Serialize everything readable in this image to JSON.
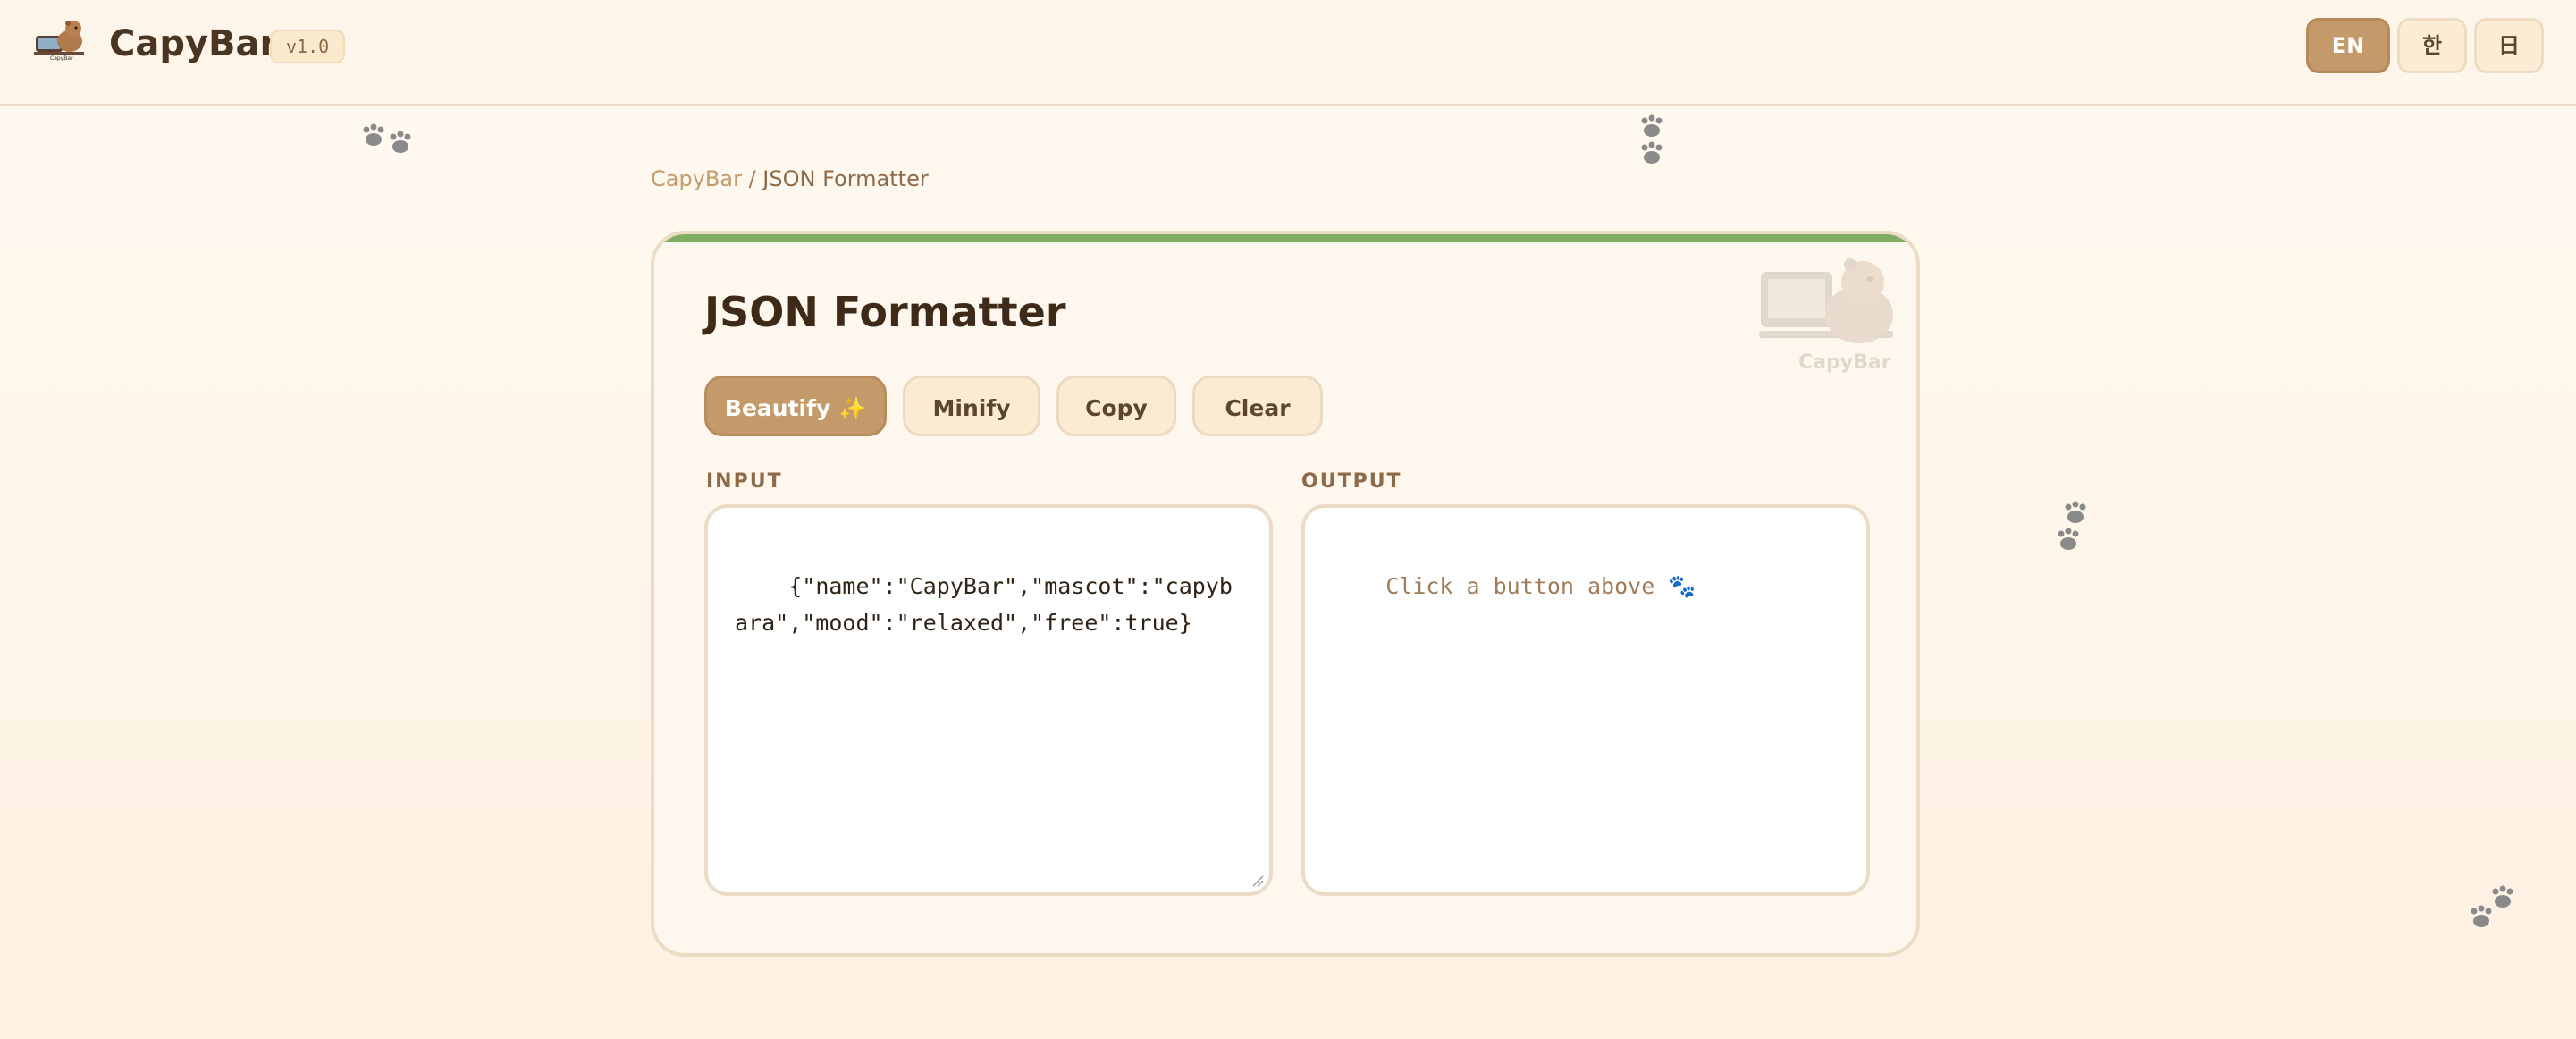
{
  "header": {
    "brand": "CapyBar",
    "version": "v1.0",
    "languages": [
      "EN",
      "한",
      "日"
    ],
    "active_language": "EN"
  },
  "breadcrumb": {
    "root": "CapyBar",
    "separator": " / ",
    "current": "JSON Formatter"
  },
  "tool": {
    "title": "JSON Formatter",
    "mascot_caption": "CapyBar",
    "buttons": {
      "beautify": "Beautify ✨",
      "minify": "Minify",
      "copy": "Copy",
      "clear": "Clear"
    },
    "input_label": "INPUT",
    "output_label": "OUTPUT",
    "input_value": "{\"name\":\"CapyBar\",\"mascot\":\"capybara\",\"mood\":\"relaxed\",\"free\":true}",
    "output_placeholder": "Click a button above 🐾"
  },
  "colors": {
    "accent": "#c49a6a",
    "accent_bar": "#7fad62",
    "text": "#4a3422",
    "background": "#fdf5ea"
  },
  "icons": [
    "capybar-logo-icon",
    "paw-print-icon",
    "capybara-mascot-icon",
    "resize-handle-icon"
  ]
}
